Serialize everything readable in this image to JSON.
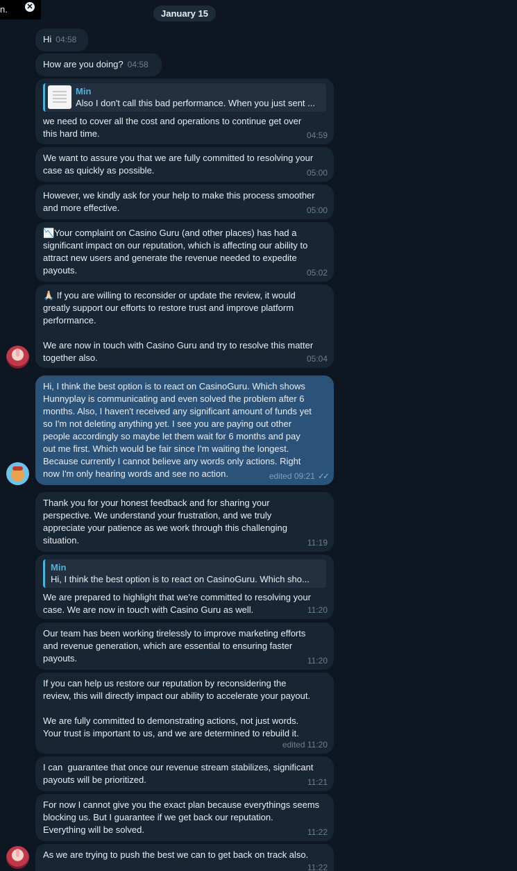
{
  "top_snippet": {
    "text": "n."
  },
  "date_separator": "January 15",
  "messages": [
    {
      "text": "Hi",
      "time": "04:58"
    },
    {
      "text": "How are you doing?",
      "time": "04:58"
    },
    {
      "reply_name": "Min",
      "reply_text": "Also I don't call this bad performance. When you just sent ...",
      "text": "we need to cover all the cost and operations to continue get over\nthis hard time.",
      "time": "04:59"
    },
    {
      "text": "We want to assure you that we are fully committed to resolving your\ncase as quickly as possible.",
      "time": "05:00"
    },
    {
      "text": "However, we kindly ask for your help to make this process smoother\nand more effective.",
      "time": "05:00"
    },
    {
      "text": "📉Your complaint on Casino Guru (and other places) has had a\nsignificant impact on our reputation, which is affecting our ability to\nattract new users and generate the revenue needed to expedite\npayouts.",
      "time": "05:02"
    },
    {
      "text": "🙏🏻 If you are willing to reconsider or update the review, it would\ngreatly support our efforts to restore trust and improve platform\nperformance.\n\nWe are now in touch with Casino Guru and try to resolve this matter\ntogether also.",
      "time": "05:04"
    },
    {
      "text": "Hi, I think the best option is to react on CasinoGuru. Which shows\nHunnyplay is communicating and even solved the problem after 6\nmonths. Also, I haven't received any significant amount of funds yet\nso I'm not deleting anything yet. I see you are paying out other\npeople accordingly so maybe let them wait for 6 months and pay\nout me first. Which would be fair since I'm waiting the longest.\nBecause currently I cannot believe any words only actions. Right\nnow I'm only hearing words and see no action.",
      "time": "edited 09:21"
    },
    {
      "text": "Thank you for your honest feedback and for sharing your\nperspective. We understand your frustration, and we truly\nappreciate your patience as we work through this challenging\nsituation.",
      "time": "11:19"
    },
    {
      "reply_name": "Min",
      "reply_text": "Hi, I think the best option is to react on CasinoGuru. Which sho...",
      "text": "We are prepared to highlight that we're committed to resolving your\ncase. We are now in touch with Casino Guru as well.",
      "time": "11:20"
    },
    {
      "text": "Our team has been working tirelessly to improve marketing efforts\nand revenue generation, which are essential to ensuring faster\npayouts.",
      "time": "11:20"
    },
    {
      "text": "If you can help us restore our reputation by reconsidering the\nreview, this will directly impact our ability to accelerate your payout.\n\nWe are fully committed to demonstrating actions, not just words.\nYour trust is important to us, and we are determined to rebuild it.",
      "time": "edited 11:20"
    },
    {
      "text": "I can  guarantee that once our revenue stream stabilizes, significant\npayouts will be prioritized.",
      "time": "11:21"
    },
    {
      "text": "For now I cannot give you the exact plan because everythings seems\nblocking us. But I guarantee if we get back our reputation.\nEverything will be solved.",
      "time": "11:22"
    },
    {
      "text": "As we are trying to push the best we can to get back on track also.",
      "time": "11:22"
    }
  ]
}
